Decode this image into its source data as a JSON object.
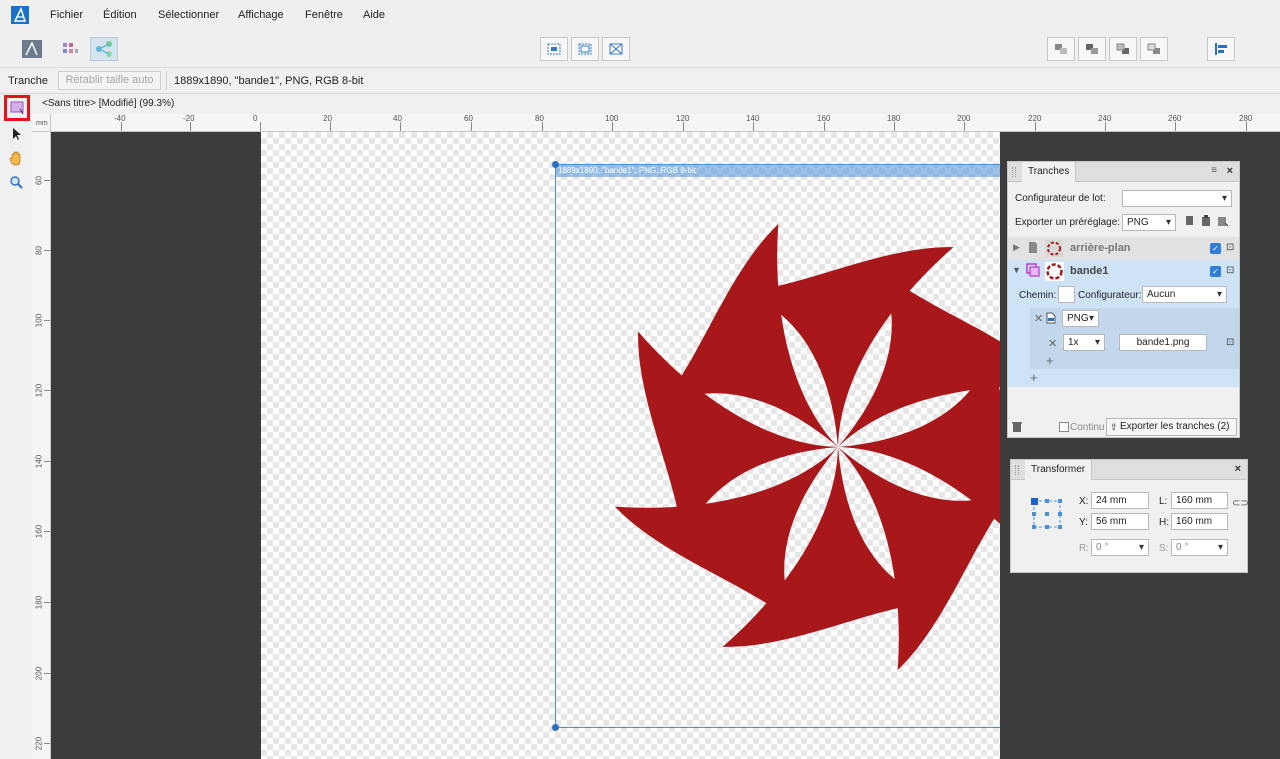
{
  "menu": [
    "Fichier",
    "Édition",
    "Sélectionner",
    "Affichage",
    "Fenêtre",
    "Aide"
  ],
  "context": {
    "tool_label": "Tranche",
    "reset_label": "Rétablir taille auto",
    "info": "1889x1890, \"bande1\", PNG, RGB 8-bit"
  },
  "document": {
    "title": "<Sans titre> [Modifié] (99.3%)"
  },
  "ruler": {
    "unit": "mm",
    "h_ticks": [
      "-40",
      "-20",
      "0",
      "20",
      "40",
      "60",
      "80",
      "100",
      "120",
      "140",
      "160",
      "180",
      "200",
      "220",
      "240",
      "260",
      "280"
    ],
    "v_ticks": [
      "60",
      "80",
      "100",
      "120",
      "140",
      "160",
      "180",
      "200",
      "220"
    ]
  },
  "canvas": {
    "slice_label": "1889x1890, \"bande1\", PNG, RGB 8-bit",
    "swirl_color": "#a8171a"
  },
  "tranches_panel": {
    "tab": "Tranches",
    "batch_label": "Configurateur de lot:",
    "batch_value": "",
    "preset_label": "Exporter un préréglage:",
    "preset_value": "PNG u...",
    "layers": [
      {
        "name": "arrière-plan",
        "checked": true
      },
      {
        "name": "bande1",
        "checked": true
      }
    ],
    "path_label": "Chemin:",
    "path_value": "",
    "config_label": "Configurateur:",
    "config_value": "Aucun",
    "format": "PNG",
    "scale": "1x",
    "filename": "bande1.png",
    "continuous_label": "Continu",
    "export_button": "Exporter les tranches (2)"
  },
  "transform_panel": {
    "tab": "Transformer",
    "x_label": "X:",
    "x_value": "24 mm",
    "y_label": "Y:",
    "y_value": "56 mm",
    "w_label": "L:",
    "w_value": "160 mm",
    "h_label": "H:",
    "h_value": "160 mm",
    "r_label": "R:",
    "r_value": "0 °",
    "s_label": "S:",
    "s_value": "0 °"
  }
}
